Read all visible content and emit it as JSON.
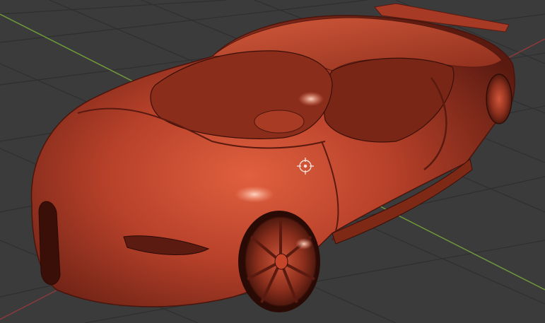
{
  "viewport": {
    "background_color": "#3b3b3b",
    "grid_color": "#2f2f2f",
    "x_axis_color": "#8a3a3a",
    "y_axis_color": "#6e9a3a",
    "object": "car-model",
    "material_color": "#c4452a",
    "origin_marker": "object-origin-icon"
  }
}
